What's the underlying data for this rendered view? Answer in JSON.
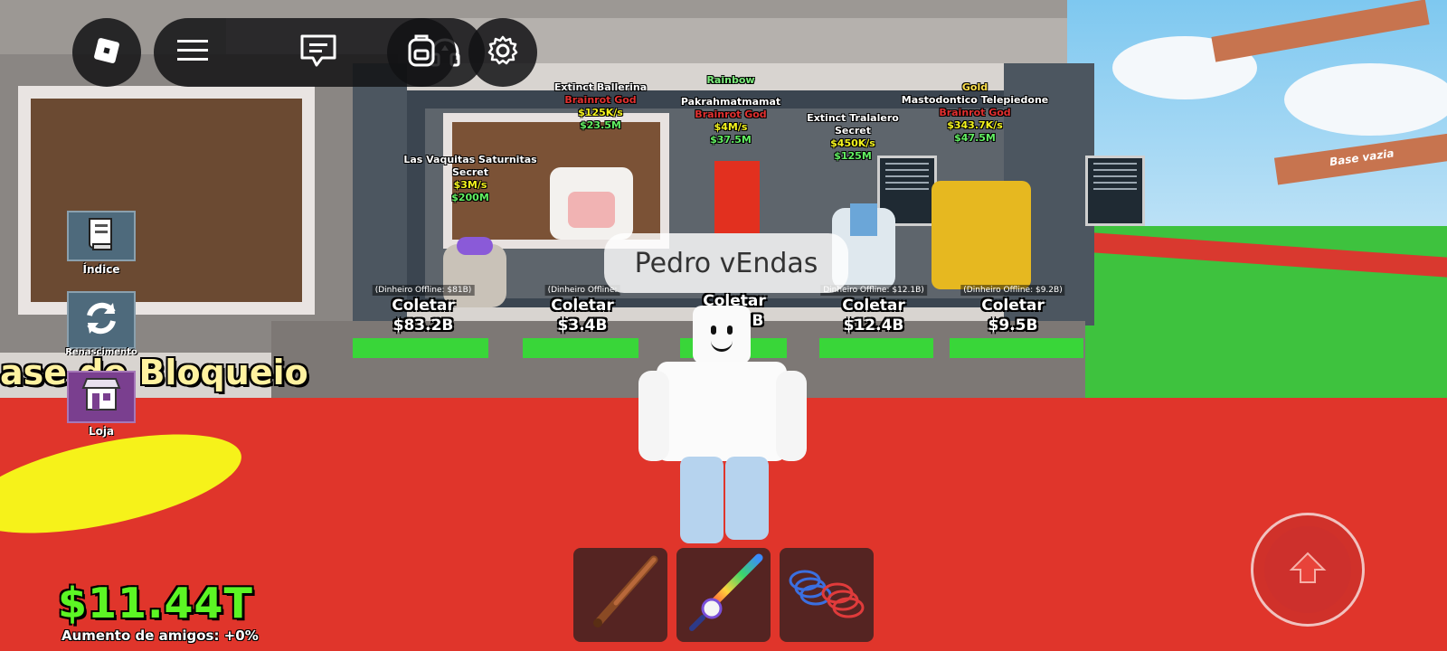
{
  "topbar": {
    "roblox_icon": "roblox-logo-icon",
    "menu_icon": "hamburger-menu-icon",
    "chat_icon": "chat-icon",
    "emote_icon": "headphones-icon",
    "backpack_icon": "backpack-icon",
    "settings_icon": "gear-icon"
  },
  "side_menu": [
    {
      "label": "Índice",
      "icon": "book-icon",
      "color": "#4e6a7c"
    },
    {
      "label": "Renascimento",
      "icon": "refresh-icon",
      "color": "#4e6a7c"
    },
    {
      "label": "Loja",
      "icon": "shop-icon",
      "color": "#7a3f8f"
    }
  ],
  "base_title": "ase de Bloqueio",
  "player_name": "Pedro vEndas",
  "stats": {
    "money": "$11.44T",
    "friends_boost": "Aumento de amigos: +0%"
  },
  "brainrots": [
    {
      "mutation": "",
      "name": "Las Vaquitas Saturnitas",
      "rarity": "Secret",
      "rate": "$3M/s",
      "price": "$200M"
    },
    {
      "mutation": "",
      "name": "Extinct Ballerina",
      "rarity": "Brainrot God",
      "rate": "$125K/s",
      "price": "$23.5M"
    },
    {
      "mutation": "Rainbow",
      "name": "Pakrahmatmamat",
      "rarity": "Brainrot God",
      "rate": "$4M/s",
      "price": "$37.5M"
    },
    {
      "mutation": "",
      "name": "Extinct Tralalero",
      "rarity": "Secret",
      "rate": "$450K/s",
      "price": "$125M"
    },
    {
      "mutation": "Gold",
      "name": "Mastodontico Telepiedone",
      "rarity": "Brainrot God",
      "rate": "$343.7K/s",
      "price": "$47.5M"
    }
  ],
  "collectors": [
    {
      "offline": "(Dinheiro Offline: $81B)",
      "label": "Coletar",
      "value": "$83.2B"
    },
    {
      "offline": "(Dinheiro Offline:",
      "label": "Coletar",
      "value": "$3.4B"
    },
    {
      "offline": "",
      "label": "Coletar",
      "value": "3B"
    },
    {
      "offline": "Dinheiro Offline: $12.1B)",
      "label": "Coletar",
      "value": "$12.4B"
    },
    {
      "offline": "(Dinheiro Offline: $9.2B)",
      "label": "Coletar",
      "value": "$9.5B"
    }
  ],
  "scene_signs": {
    "base_empty": "Base vazia"
  },
  "hotbar": [
    {
      "item": "bat-icon"
    },
    {
      "item": "unicorn-sword-icon"
    },
    {
      "item": "spring-coil-icon"
    }
  ],
  "jump_icon": "arrow-up-icon",
  "colors": {
    "money_green": "#5cf524",
    "floor_red": "#e0352b",
    "pad_green": "#39d639"
  }
}
